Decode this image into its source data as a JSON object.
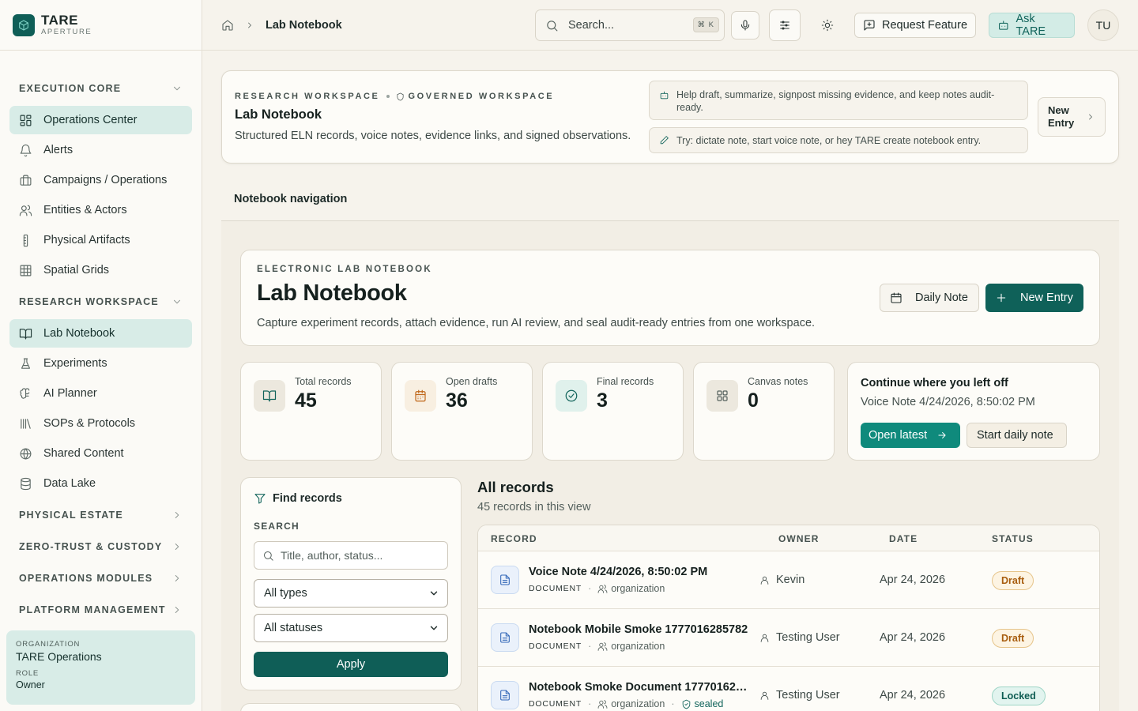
{
  "brand": {
    "name": "TARE",
    "sub": "APERTURE"
  },
  "sidebar": {
    "sections": [
      {
        "label": "EXECUTION CORE",
        "expanded": true,
        "items": [
          {
            "label": "Operations Center",
            "icon": "dashboard-icon",
            "active": true
          },
          {
            "label": "Alerts",
            "icon": "bell-icon"
          },
          {
            "label": "Campaigns / Operations",
            "icon": "briefcase-icon"
          },
          {
            "label": "Entities & Actors",
            "icon": "users-icon"
          },
          {
            "label": "Physical Artifacts",
            "icon": "tag-icon"
          },
          {
            "label": "Spatial Grids",
            "icon": "grid-icon"
          }
        ]
      },
      {
        "label": "RESEARCH WORKSPACE",
        "expanded": true,
        "items": [
          {
            "label": "Lab Notebook",
            "icon": "book-icon",
            "active": true
          },
          {
            "label": "Experiments",
            "icon": "flask-icon"
          },
          {
            "label": "AI Planner",
            "icon": "brain-icon"
          },
          {
            "label": "SOPs & Protocols",
            "icon": "library-icon"
          },
          {
            "label": "Shared Content",
            "icon": "globe-icon"
          },
          {
            "label": "Data Lake",
            "icon": "database-icon"
          }
        ]
      },
      {
        "label": "PHYSICAL ESTATE",
        "expanded": false
      },
      {
        "label": "ZERO-TRUST & CUSTODY",
        "expanded": false
      },
      {
        "label": "OPERATIONS MODULES",
        "expanded": false
      },
      {
        "label": "PLATFORM MANAGEMENT",
        "expanded": false
      }
    ],
    "org": {
      "org_label": "ORGANIZATION",
      "org_name": "TARE Operations",
      "role_label": "ROLE",
      "role": "Owner"
    }
  },
  "topbar": {
    "breadcrumb": "Lab Notebook",
    "search_placeholder": "Search...",
    "search_shortcut": "⌘ K",
    "request_feature": "Request Feature",
    "ask": "Ask TARE",
    "avatar": "TU"
  },
  "banner": {
    "eyebrow": "RESEARCH WORKSPACE",
    "eyebrow2": "GOVERNED WORKSPACE",
    "title": "Lab Notebook",
    "desc": "Structured ELN records, voice notes, evidence links, and signed observations.",
    "hint1": "Help draft, summarize, signpost missing evidence, and keep notes audit-ready.",
    "hint2": "Try: dictate note, start voice note, or hey TARE create notebook entry.",
    "new_entry_line1": "New",
    "new_entry_line2": "Entry"
  },
  "notebook_nav": "Notebook navigation",
  "hero": {
    "eyebrow": "ELECTRONIC LAB NOTEBOOK",
    "title": "Lab Notebook",
    "desc": "Capture experiment records, attach evidence, run AI review, and seal audit-ready entries from one workspace.",
    "daily_note": "Daily Note",
    "new_entry": "New Entry"
  },
  "stats": [
    {
      "label": "Total records",
      "value": "45",
      "icon": "book-open-icon",
      "color": "#10635a",
      "bg": "#ece8de"
    },
    {
      "label": "Open drafts",
      "value": "36",
      "icon": "calendar-icon",
      "color": "#c0671a",
      "bg": "#f8efe1"
    },
    {
      "label": "Final records",
      "value": "3",
      "icon": "check-circle-icon",
      "color": "#10635a",
      "bg": "#e0f1ec"
    },
    {
      "label": "Canvas notes",
      "value": "0",
      "icon": "grid-icon",
      "color": "#55615d",
      "bg": "#ece8de"
    }
  ],
  "continue": {
    "title": "Continue where you left off",
    "subtitle": "Voice Note 4/24/2026, 8:50:02 PM",
    "open_latest": "Open latest",
    "start_daily": "Start daily note"
  },
  "filters": {
    "title": "Find records",
    "search_label": "SEARCH",
    "search_placeholder": "Title, author, status...",
    "type_value": "All types",
    "status_value": "All statuses",
    "apply": "Apply"
  },
  "records": {
    "title": "All records",
    "count": "45 records in this view",
    "columns": [
      "RECORD",
      "OWNER",
      "DATE",
      "STATUS"
    ],
    "rows": [
      {
        "title": "Voice Note 4/24/2026, 8:50:02 PM",
        "kind": "DOCUMENT",
        "scope": "organization",
        "sealed": "",
        "owner": "Kevin",
        "date": "Apr 24, 2026",
        "status": "Draft",
        "status_kind": "draft"
      },
      {
        "title": "Notebook Mobile Smoke 1777016285782",
        "kind": "DOCUMENT",
        "scope": "organization",
        "sealed": "",
        "owner": "Testing User",
        "date": "Apr 24, 2026",
        "status": "Draft",
        "status_kind": "draft"
      },
      {
        "title": "Notebook Smoke Document 177701627...",
        "kind": "DOCUMENT",
        "scope": "organization",
        "sealed": "sealed",
        "owner": "Testing User",
        "date": "Apr 24, 2026",
        "status": "Locked",
        "status_kind": "locked"
      }
    ]
  }
}
